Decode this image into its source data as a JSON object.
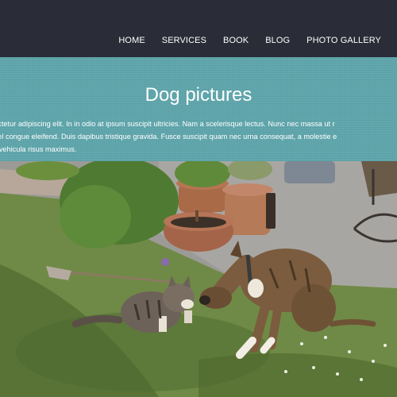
{
  "nav": {
    "items": [
      {
        "label": "HOME"
      },
      {
        "label": "SERVICES"
      },
      {
        "label": "BOOK"
      },
      {
        "label": "BLOG"
      },
      {
        "label": "PHOTO GALLERY"
      }
    ]
  },
  "banner": {
    "title": "Dog pictures",
    "lines": [
      "et, consectetur adipiscing elit. In in odio at ipsum suscipit ultricies. Nam a scelerisque lectus. Nunc nec massa ut r",
      "a turpis vel congue eleifend. Duis dapibus tristique gravida. Fusce suscipit quam nec urna consequat, a molestie e",
      "ere, eget vehicula risus maximus."
    ]
  },
  "colors": {
    "topbar": "#2a2c37",
    "banner": "#5fa6ac",
    "text": "#ffffff"
  },
  "photo": {
    "subject": "cat-and-dog-on-lawn-photo"
  }
}
